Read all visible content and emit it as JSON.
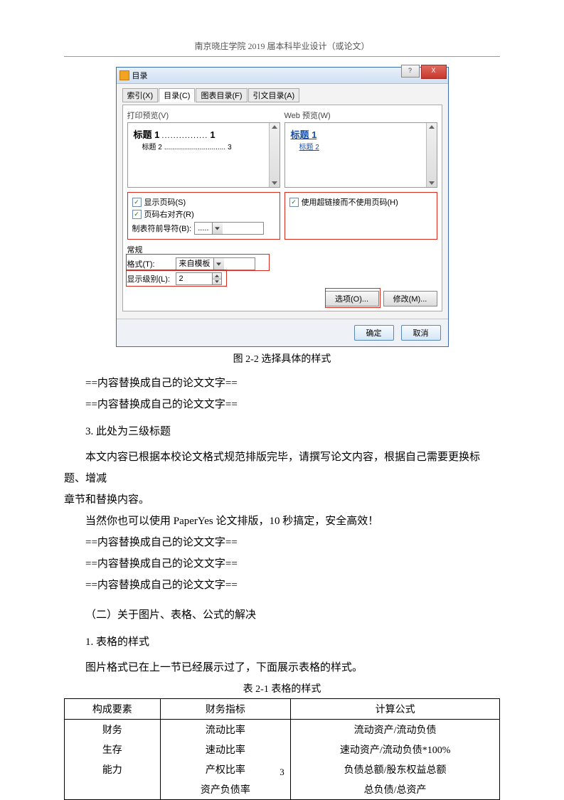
{
  "header": "南京晓庄学院 2019 届本科毕业设计（或论文）",
  "dialog": {
    "title": "目录",
    "btn_help": "?",
    "btn_close": "X",
    "tabs": [
      "索引(X)",
      "目录(C)",
      "图表目录(F)",
      "引文目录(A)"
    ],
    "preview_left_label": "打印预览(V)",
    "preview_right_label": "Web 预览(W)",
    "pv_h1": "标题 1",
    "pv_dots": "................",
    "pv_h1_num": "1",
    "pv_h2": "标题 2",
    "pv_h2_dots": "...............................",
    "pv_h2_num": "3",
    "pv_link1": "标题 1",
    "pv_link2": "标题 2",
    "chk1": "显示页码(S)",
    "chk2": "页码右对齐(R)",
    "chk3": "使用超链接而不使用页码(H)",
    "leader_label": "制表符前导符(B):",
    "leader_value": ".....",
    "general_label": "常规",
    "format_label": "格式(T):",
    "format_value": "来自模板",
    "levels_label": "显示级别(L):",
    "levels_value": "2",
    "btn_options": "选项(O)...",
    "btn_modify": "修改(M)...",
    "btn_ok": "确定",
    "btn_cancel": "取消"
  },
  "caption1": "图 2-2 选择具体的样式",
  "placeholder": "==内容替换成自己的论文文字==",
  "heading3": "3. 此处为三级标题",
  "para1": "本文内容已根据本校论文格式规范排版完毕，请撰写论文内容，根据自己需要更换标题、增减章节和替换内容。",
  "para1_noindent_prefix": "章节和替换内容。",
  "para2": "当然你也可以使用 PaperYes 论文排版，10 秒搞定，安全高效！",
  "heading2": "（二）关于图片、表格、公式的解决",
  "heading_tbl": "1. 表格的样式",
  "para_tbl": "图片格式已在上一节已经展示过了，下面展示表格的样式。",
  "table_caption": "表 2-1  表格的样式",
  "table": {
    "headers": [
      "构成要素",
      "财务指标",
      "计算公式"
    ],
    "rows": [
      [
        "财务",
        "流动比率",
        "流动资产/流动负债"
      ],
      [
        "生存",
        "速动比率",
        "速动资产/流动负债*100%"
      ],
      [
        "能力",
        "产权比率",
        "负债总额/股东权益总额"
      ],
      [
        "",
        "资产负债率",
        "总负债/总资产"
      ]
    ]
  },
  "page_number": "3"
}
